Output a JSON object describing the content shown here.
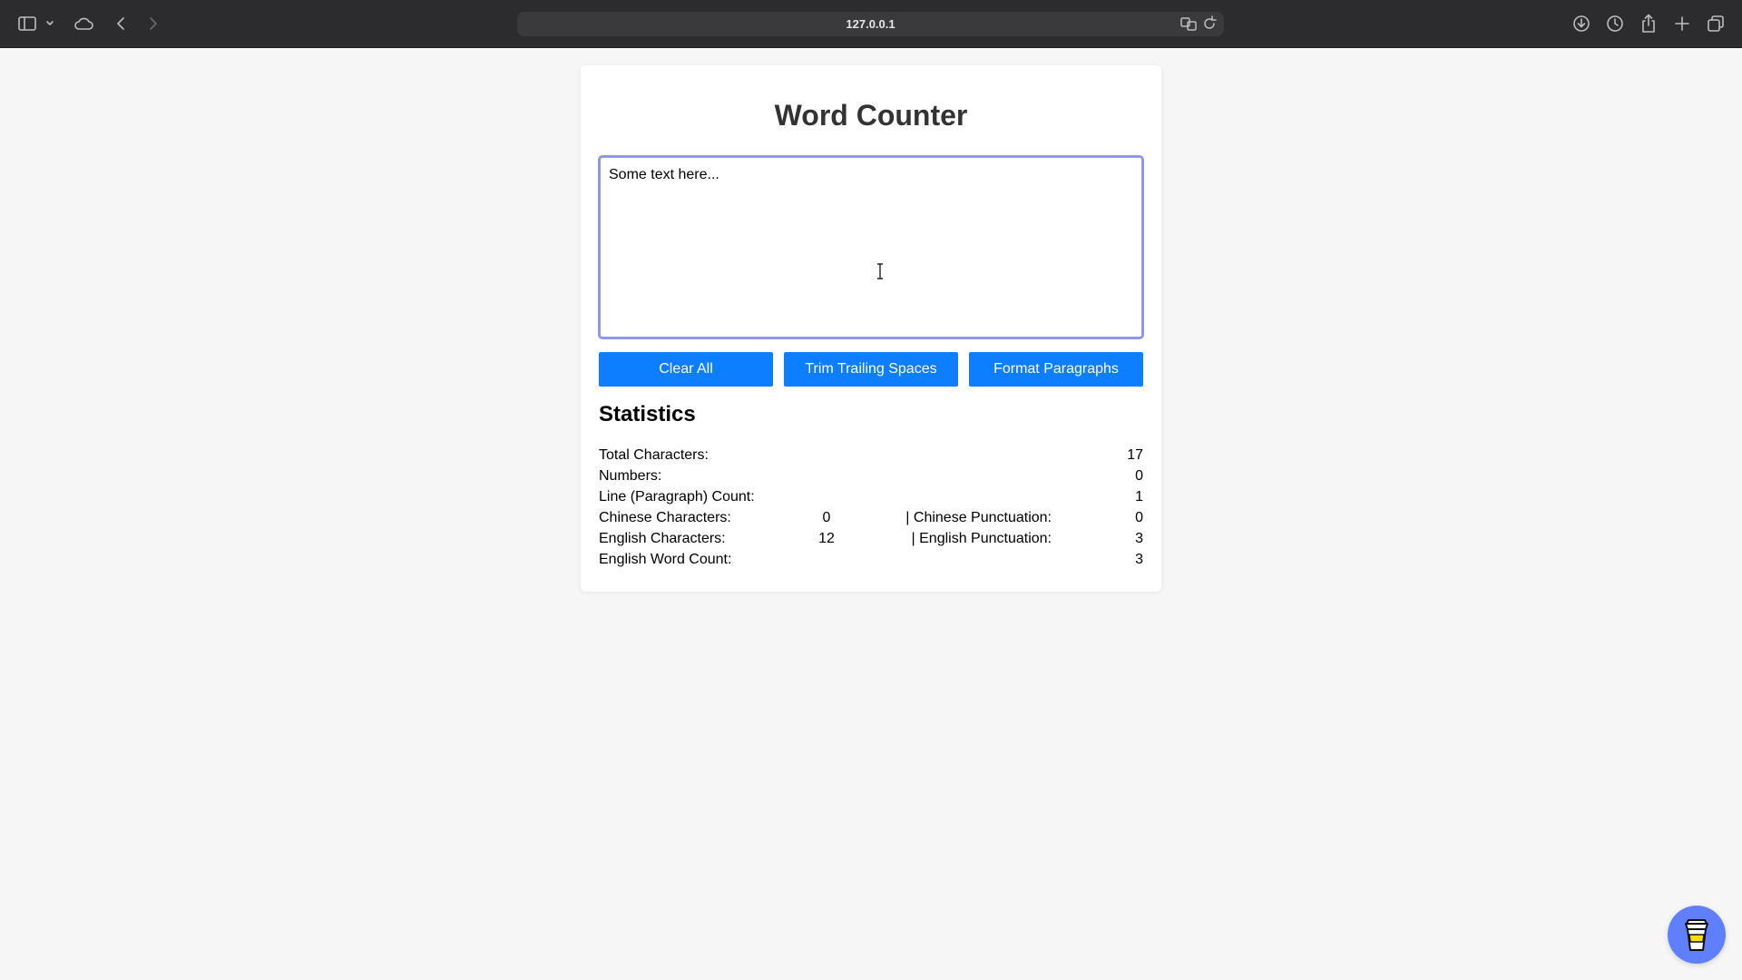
{
  "browser": {
    "url": "127.0.0.1",
    "icons": [
      "sidebar-icon",
      "chevron-down-icon",
      "cloud-icon",
      "back-icon",
      "forward-icon",
      "translate-icon",
      "reload-icon",
      "download-icon",
      "history-icon",
      "share-icon",
      "new-tab-icon",
      "tabs-overview-icon"
    ]
  },
  "app": {
    "title": "Word Counter",
    "textarea_value": "Some text here...",
    "buttons": {
      "clear": "Clear All",
      "trim": "Trim Trailing Spaces",
      "format": "Format Paragraphs"
    },
    "accent_color": "#0d7eff"
  },
  "statistics": {
    "heading": "Statistics",
    "total_characters": {
      "label": "Total Characters:",
      "value": "17"
    },
    "numbers": {
      "label": "Numbers:",
      "value": "0"
    },
    "line_count": {
      "label": "Line (Paragraph) Count:",
      "value": "1"
    },
    "chinese_characters": {
      "label": "Chinese Characters:",
      "value": "0"
    },
    "chinese_punctuation": {
      "label": "| Chinese Punctuation:",
      "value": "0"
    },
    "english_characters": {
      "label": "English Characters:",
      "value": "12"
    },
    "english_punctuation": {
      "label": "| English Punctuation:",
      "value": "3"
    },
    "english_word_count": {
      "label": "English Word Count:",
      "value": "3"
    }
  },
  "floating_button": {
    "icon": "coffee-cup-icon",
    "color": "#5f7fff"
  }
}
